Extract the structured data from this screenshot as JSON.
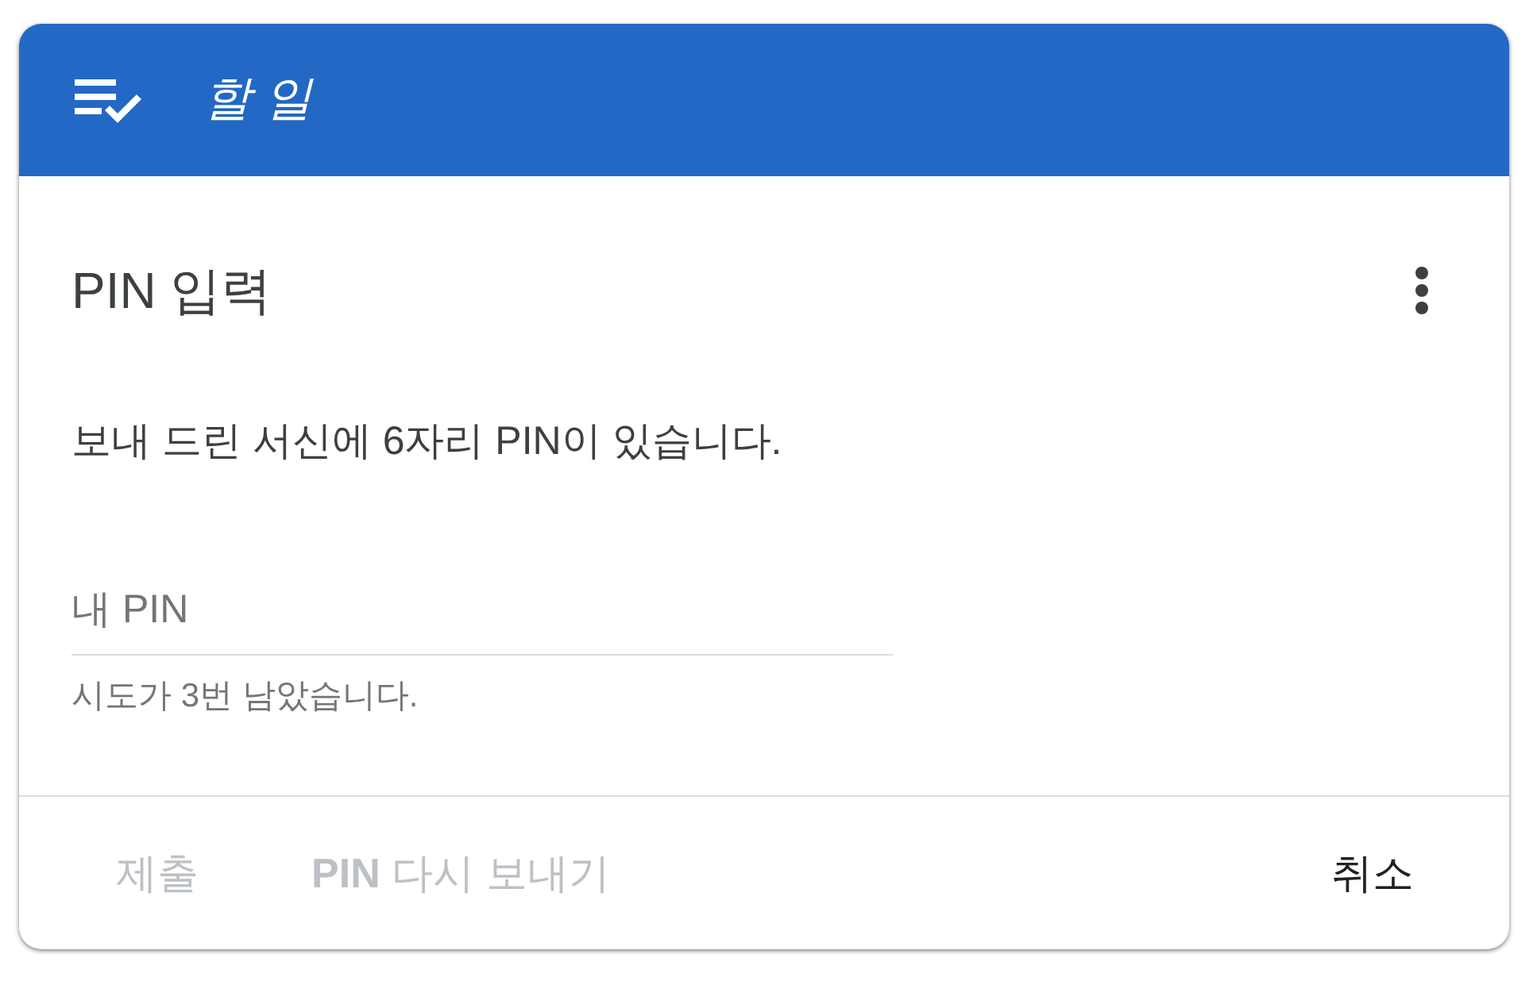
{
  "header": {
    "title": "할 일"
  },
  "dialog": {
    "title": "PIN 입력",
    "message": "보내 드린 서신에 6자리 PIN이 있습니다.",
    "pin_field": {
      "placeholder": "내 PIN",
      "helper": "시도가 3번 남았습니다."
    }
  },
  "actions": {
    "start": [
      {
        "label": "제출",
        "disabled": true
      },
      {
        "label": "**PIN** 다시 보내기",
        "disabled": true
      }
    ],
    "end": [
      {
        "label": "취소",
        "disabled": false
      }
    ]
  }
}
